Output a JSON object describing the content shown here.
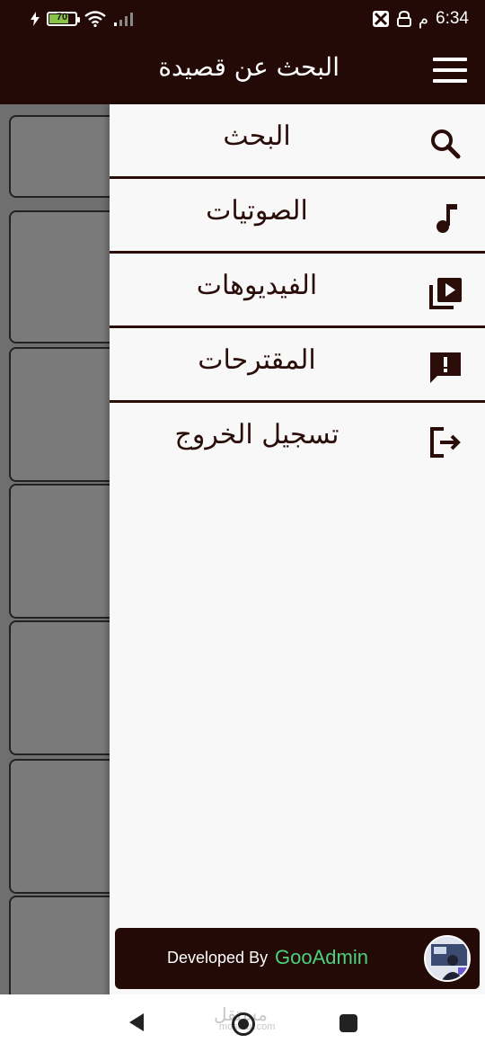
{
  "status": {
    "time": "6:34",
    "ampm": "م",
    "battery": "70"
  },
  "appbar": {
    "title": "البحث عن قصيدة"
  },
  "drawer": {
    "items": [
      {
        "label": "البحث",
        "icon": "search-icon"
      },
      {
        "label": "الصوتيات",
        "icon": "music-note-icon"
      },
      {
        "label": "الفيديوهات",
        "icon": "video-library-icon"
      },
      {
        "label": "المقترحات",
        "icon": "feedback-icon"
      },
      {
        "label": "تسجيل الخروج",
        "icon": "logout-icon"
      }
    ],
    "footer": {
      "developed_by": "Developed By",
      "developer": "GooAdmin"
    }
  },
  "watermark": {
    "brand": "مستقل",
    "domain": "mostaql.com"
  },
  "colors": {
    "primary": "#230a06",
    "drawer_bg": "#f8f8f8",
    "accent_green": "#4cd07a"
  }
}
